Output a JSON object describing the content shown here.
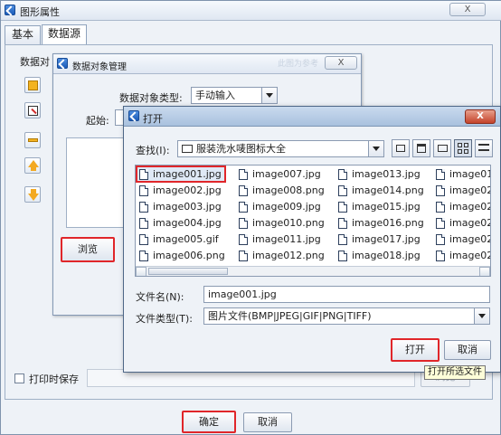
{
  "main_window": {
    "title": "图形属性",
    "close": "X",
    "tabs": [
      {
        "label": "基本"
      },
      {
        "label": "数据源"
      }
    ],
    "data_object_label": "数据对",
    "print_save_label": "打印时保存",
    "ok": "确定",
    "cancel": "取消",
    "dim_button": "浏览",
    "faded_title_hint": "此图为参考"
  },
  "data_dialog": {
    "title": "数据对象管理",
    "close": "X",
    "type_label": "数据对象类型:",
    "type_value": "手动输入",
    "start_label": "起始:",
    "browse": "浏览"
  },
  "open_dialog": {
    "title": "打开",
    "close": "X",
    "lookin_label": "查找(I):",
    "lookin_value": "服装洗水唛图标大全",
    "filename_label": "文件名(N):",
    "filename_value": "image001.jpg",
    "filetype_label": "文件类型(T):",
    "filetype_value": "图片文件(BMP|JPEG|GIF|PNG|TIFF)",
    "open": "打开",
    "cancel": "取消",
    "tooltip": "打开所选文件",
    "files": [
      [
        "image001.jpg",
        "image002.jpg",
        "image003.jpg",
        "image004.jpg",
        "image005.gif",
        "image006.png"
      ],
      [
        "image007.jpg",
        "image008.png",
        "image009.jpg",
        "image010.png",
        "image011.jpg",
        "image012.png"
      ],
      [
        "image013.jpg",
        "image014.png",
        "image015.jpg",
        "image016.png",
        "image017.jpg",
        "image018.jpg"
      ],
      [
        "image01",
        "image02",
        "image02",
        "image02",
        "image02",
        "image02"
      ]
    ]
  },
  "colors": {
    "highlight_red": "#e0262a",
    "accent_blue": "#2d6cc0"
  }
}
